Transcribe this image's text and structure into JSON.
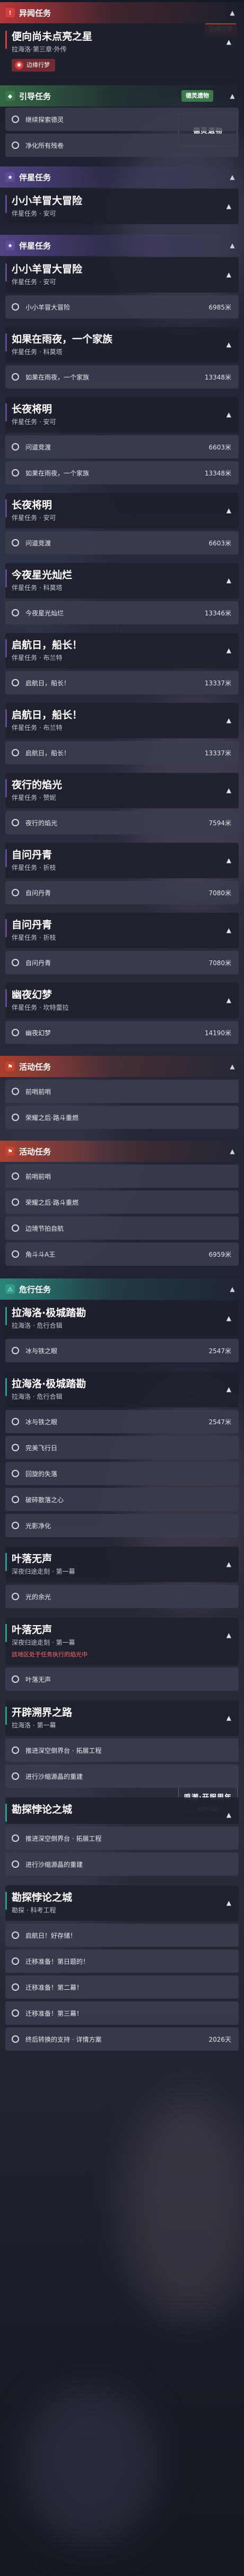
{
  "colors": {
    "bounty": "#d83c3c",
    "guide": "#3a7a4a",
    "companion": "#5e4b9a",
    "event": "#c8442f",
    "danger": "#2d9c8a"
  },
  "sections": {
    "bounty": {
      "title": "异闻任务",
      "icon": "exclaim-icon"
    },
    "guide": {
      "title": "引导任务",
      "icon": "guide-icon"
    },
    "companion": {
      "title": "伴星任务",
      "icon": "star-icon"
    },
    "event": {
      "title": "活动任务",
      "icon": "flag-icon"
    },
    "danger": {
      "title": "危行任务",
      "icon": "warning-icon"
    }
  },
  "bounty_card": {
    "title": "便向尚未点亮之星",
    "sub": "拉海洛·第三章·外传",
    "tag": "边缘行梦",
    "chip": "边缘行梦"
  },
  "guide": {
    "rows": [
      "继续探索德灵",
      "净化所有残卷"
    ],
    "panel_logo": "德灵遗物",
    "panel_chip": "德灵遗物"
  },
  "companion_first": {
    "title": "小小羊冒大冒险",
    "sub": "伴星任务 · 安可"
  },
  "companion": [
    {
      "title": "小小羊冒大冒险",
      "sub": "伴星任务 · 安可",
      "rows": [
        {
          "label": "小小羊冒大冒险",
          "dist": "6985米"
        }
      ]
    },
    {
      "title": "如果在雨夜，一个家族",
      "sub": "伴星任务 · 科莫塔",
      "rows": [
        {
          "label": "如果在雨夜，一个家族",
          "dist": "13348米"
        }
      ]
    },
    {
      "title": "长夜将明",
      "sub": "伴星任务 · 安可",
      "rows": [
        {
          "label": "问道竞渡",
          "dist": "6603米"
        },
        {
          "label": "如果在雨夜，一个家族",
          "dist": "13348米"
        }
      ]
    },
    {
      "title": "长夜将明",
      "sub": "伴星任务 · 安可",
      "rows": [
        {
          "label": "问道竞渡",
          "dist": "6603米"
        }
      ]
    },
    {
      "title": "今夜星光灿烂",
      "sub": "伴星任务 · 科莫塔",
      "rows": [
        {
          "label": "今夜星光灿烂",
          "dist": "13346米"
        }
      ]
    },
    {
      "title": "启航日，船长！",
      "sub": "伴星任务 · 布兰特",
      "rows": [
        {
          "label": "启航日，船长！",
          "dist": "13337米"
        }
      ]
    },
    {
      "title": "启航日，船长！",
      "sub": "伴星任务 · 布兰特",
      "rows": [
        {
          "label": "启航日，船长！",
          "dist": "13337米"
        }
      ]
    },
    {
      "title": "夜行的焰光",
      "sub": "伴星任务 · 赞妮",
      "rows": [
        {
          "label": "夜行的焰光",
          "dist": "7594米"
        }
      ]
    },
    {
      "title": "自问丹青",
      "sub": "伴星任务 · 折枝",
      "rows": [
        {
          "label": "自问丹青",
          "dist": "7080米"
        }
      ]
    },
    {
      "title": "自问丹青",
      "sub": "伴星任务 · 折枝",
      "rows": [
        {
          "label": "自问丹青",
          "dist": "7080米"
        }
      ]
    },
    {
      "title": "幽夜幻梦",
      "sub": "伴星任务 · 坎特蕾拉",
      "rows": [
        {
          "label": "幽夜幻梦",
          "dist": "14190米"
        }
      ]
    }
  ],
  "event": [
    {
      "rows": [
        {
          "label": "前哨前哨",
          "dist": ""
        },
        {
          "label": "荣耀之后·路斗重燃",
          "dist": ""
        }
      ]
    },
    {
      "rows": [
        {
          "label": "前哨前哨",
          "dist": ""
        },
        {
          "label": "荣耀之后·路斗重燃",
          "dist": ""
        },
        {
          "label": "边境节拍自航",
          "dist": ""
        },
        {
          "label": "角斗斗A王",
          "dist": "6959米"
        }
      ]
    }
  ],
  "event_panel": {
    "logo": "鸣潮·开服周年",
    "dist": "6959米"
  },
  "danger": [
    {
      "title": "拉海洛·极城踏勘",
      "sub": "拉海洛 · 危行合辑",
      "rows": [
        {
          "label": "冰与铁之眼",
          "dist": "2547米"
        }
      ]
    },
    {
      "title": "拉海洛·极城踏勘",
      "sub": "拉海洛 · 危行合辑",
      "rows": [
        {
          "label": "冰与铁之眼",
          "dist": "2547米"
        },
        {
          "label": "完美飞行日",
          "dist": ""
        },
        {
          "label": "回旋的失落",
          "dist": ""
        },
        {
          "label": "破碎散落之心",
          "dist": ""
        },
        {
          "label": "光影净化",
          "dist": ""
        }
      ]
    },
    {
      "title": "叶落无声",
      "sub": "深夜归途走刻 · 第一幕",
      "rows": [
        {
          "label": "光的余光",
          "dist": ""
        }
      ]
    },
    {
      "title": "叶落无声",
      "sub": "深夜归途走刻 · 第一幕",
      "rows": [
        {
          "label": "叶落无声",
          "dist": ""
        }
      ],
      "warn": "該地区处于任务执行的焰光中"
    },
    {
      "title": "开辟溯界之路",
      "sub": "拉海洛 · 第一幕",
      "rows": [
        {
          "label": "推进深空倒界台 · 拓展工程",
          "dist": ""
        },
        {
          "label": "进行沙缩源晶的重建",
          "dist": ""
        }
      ]
    },
    {
      "title": "勘探悖论之城",
      "sub": "",
      "rows": [
        {
          "label": "推进深空倒界台 · 拓展工程",
          "dist": ""
        },
        {
          "label": "进行沙缩源晶的重建",
          "dist": ""
        }
      ]
    },
    {
      "title": "勘探悖论之城",
      "sub": "勘探 · 科考工程",
      "rows": [
        {
          "label": "启航日！好存储！",
          "dist": ""
        },
        {
          "label": "迁移准备！第日题的！",
          "dist": ""
        },
        {
          "label": "迁移准备！第二幕！",
          "dist": ""
        },
        {
          "label": "迁移准备！第三幕！",
          "dist": ""
        },
        {
          "label": "终后转换的支持 · 详情方案",
          "dist": "2026天"
        }
      ]
    }
  ]
}
